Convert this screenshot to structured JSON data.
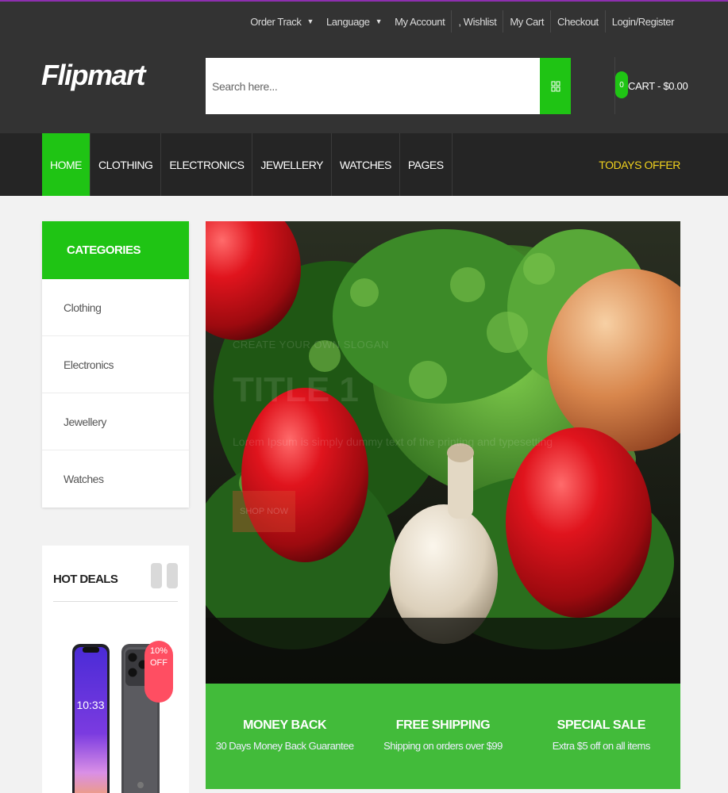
{
  "header": {
    "links": [
      {
        "label": "Order Track",
        "dropdown": true
      },
      {
        "label": "Language",
        "dropdown": true
      },
      {
        "label": "My Account",
        "dropdown": false
      },
      {
        "label": ", Wishlist",
        "dropdown": false
      },
      {
        "label": "My Cart",
        "dropdown": false
      },
      {
        "label": "Checkout",
        "dropdown": false
      },
      {
        "label": "Login/Register",
        "dropdown": false
      }
    ],
    "logo": "Flipmart",
    "search": {
      "placeholder": "Search here..."
    },
    "cart": {
      "count": "0",
      "label": "CART - $0.00"
    }
  },
  "nav": {
    "items": [
      {
        "label": "HOME",
        "active": true
      },
      {
        "label": "CLOTHING",
        "active": false
      },
      {
        "label": "ELECTRONICS",
        "active": false
      },
      {
        "label": "JEWELLERY",
        "active": false
      },
      {
        "label": "WATCHES",
        "active": false
      },
      {
        "label": "PAGES",
        "active": false
      }
    ],
    "offer": "TODAYS OFFER"
  },
  "categories": {
    "title": "CATEGORIES",
    "items": [
      "Clothing",
      "Electronics",
      "Jewellery",
      "Watches"
    ]
  },
  "hot_deals": {
    "title": "HOT DEALS",
    "badge": "10%\nOFF",
    "phone_time": "10:33"
  },
  "slider": {
    "slogan": "CREATE YOUR OWN SLOGAN",
    "title": "TITLE 1",
    "description": "Lorem Ipsum is simply dummy text of the printing and typesetting",
    "button": "SHOP NOW"
  },
  "info": [
    {
      "title": "MONEY BACK",
      "desc": "30 Days Money Back Guarantee"
    },
    {
      "title": "FREE SHIPPING",
      "desc": "Shipping on orders over $99"
    },
    {
      "title": "SPECIAL SALE",
      "desc": "Extra $5 off on all items"
    }
  ],
  "colors": {
    "accent": "#1fc414",
    "header_bg": "#333333",
    "nav_bg": "#252525",
    "offer": "#f1d21e",
    "info_bg": "#42bb3a",
    "badge": "#ff4e62"
  }
}
